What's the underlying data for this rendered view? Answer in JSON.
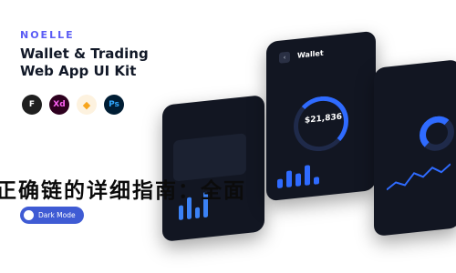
{
  "brand": "NOELLE",
  "title_line1": "Wallet & Trading",
  "title_line2": "Web App UI Kit",
  "tools": [
    "F",
    "Xd",
    "◆",
    "Ps"
  ],
  "darkmode_label": "Dark Mode",
  "wallet_title": "Wallet",
  "balance": "$21,836",
  "headline": "正确链的详细指南：全面"
}
